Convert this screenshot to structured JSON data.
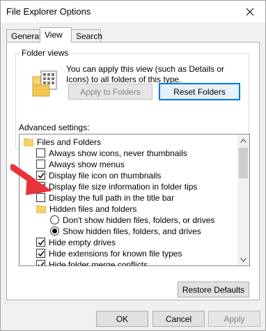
{
  "window": {
    "title": "File Explorer Options",
    "close_icon": "close-icon"
  },
  "tabs": [
    {
      "label": "General",
      "active": false
    },
    {
      "label": "View",
      "active": true
    },
    {
      "label": "Search",
      "active": false
    }
  ],
  "folder_views": {
    "group_label": "Folder views",
    "description": "You can apply this view (such as Details or Icons) to all folders of this type.",
    "apply_button": "Apply to Folders",
    "apply_enabled": false,
    "reset_button": "Reset Folders"
  },
  "advanced": {
    "label": "Advanced settings:",
    "items": [
      {
        "type": "folder",
        "label": "Files and Folders",
        "indent": 0
      },
      {
        "type": "checkbox",
        "label": "Always show icons, never thumbnails",
        "checked": false,
        "indent": 1
      },
      {
        "type": "checkbox",
        "label": "Always show menus",
        "checked": false,
        "indent": 1
      },
      {
        "type": "checkbox",
        "label": "Display file icon on thumbnails",
        "checked": true,
        "indent": 1
      },
      {
        "type": "checkbox",
        "label": "Display file size information in folder tips",
        "checked": true,
        "indent": 1
      },
      {
        "type": "checkbox",
        "label": "Display the full path in the title bar",
        "checked": false,
        "indent": 1
      },
      {
        "type": "folder",
        "label": "Hidden files and folders",
        "indent": 1
      },
      {
        "type": "radio",
        "label": "Don't show hidden files, folders, or drives",
        "checked": false,
        "indent": 2
      },
      {
        "type": "radio",
        "label": "Show hidden files, folders, and drives",
        "checked": true,
        "indent": 2
      },
      {
        "type": "checkbox",
        "label": "Hide empty drives",
        "checked": true,
        "indent": 1
      },
      {
        "type": "checkbox",
        "label": "Hide extensions for known file types",
        "checked": true,
        "indent": 1
      },
      {
        "type": "checkbox",
        "label": "Hide folder merge conflicts",
        "checked": true,
        "indent": 1
      }
    ],
    "restore_button": "Restore Defaults"
  },
  "footer": {
    "ok": "OK",
    "cancel": "Cancel",
    "apply": "Apply",
    "apply_enabled": false
  },
  "colors": {
    "annotation_arrow": "#e8333b",
    "focus_border": "#0078d7",
    "folder_yellow": "#f6d36b"
  }
}
